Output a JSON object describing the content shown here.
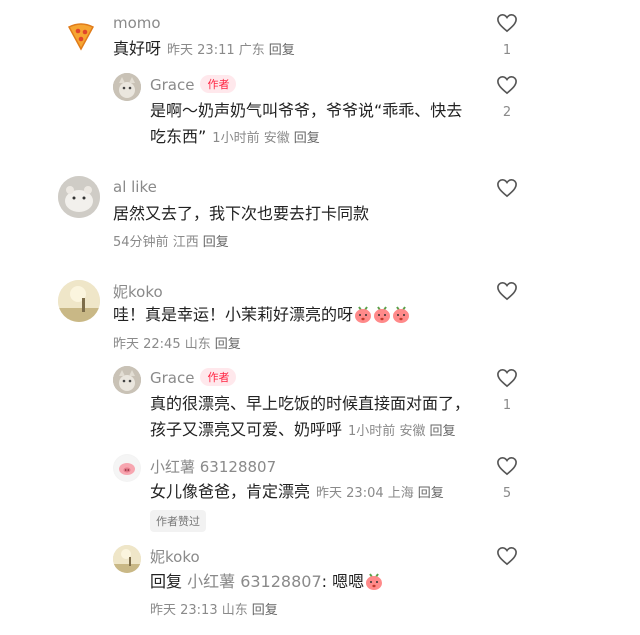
{
  "comments": [
    {
      "name": "momo",
      "text": "真好呀",
      "date": "昨天 23:11",
      "loc": "广东",
      "reply": "回复",
      "likes": "1"
    },
    {
      "name": "Grace",
      "tag": "作者",
      "text1": "是啊～奶声奶气叫爷爷，爷爷说“乖乖、快去",
      "text2": "吃东西”",
      "date": "1小时前",
      "loc": "安徽",
      "reply": "回复",
      "likes": "2"
    },
    {
      "name": "al like",
      "text": "居然又去了，我下次也要去打卡同款",
      "date": "54分钟前",
      "loc": "江西",
      "reply": "回复",
      "likes": ""
    },
    {
      "name": "妮koko",
      "text": "哇！真是幸运！小茉莉好漂亮的呀",
      "date": "昨天 22:45",
      "loc": "山东",
      "reply": "回复",
      "likes": ""
    },
    {
      "name": "Grace",
      "tag": "作者",
      "text1": "真的很漂亮、早上吃饭的时候直接面对面了，",
      "text2": "孩子又漂亮又可爱、奶呼呼",
      "date": "1小时前",
      "loc": "安徽",
      "reply": "回复",
      "likes": "1"
    },
    {
      "name": "小红薯 63128807",
      "text": "女儿像爸爸，肯定漂亮",
      "date": "昨天 23:04",
      "loc": "上海",
      "reply": "回复",
      "likes": "5",
      "badge": "作者赞过"
    },
    {
      "name": "妮koko",
      "prefix": "回复",
      "mention": "小红薯 63128807",
      "text": ": 嗯嗯",
      "date": "昨天 23:13",
      "loc": "山东",
      "reply": "回复",
      "likes": ""
    }
  ],
  "icons": {
    "like": "heart-outline-icon",
    "emoji": "pink-blushing-face-icon"
  },
  "colors": {
    "author_tag": "#ff2442",
    "meta": "#8a8a8a"
  }
}
